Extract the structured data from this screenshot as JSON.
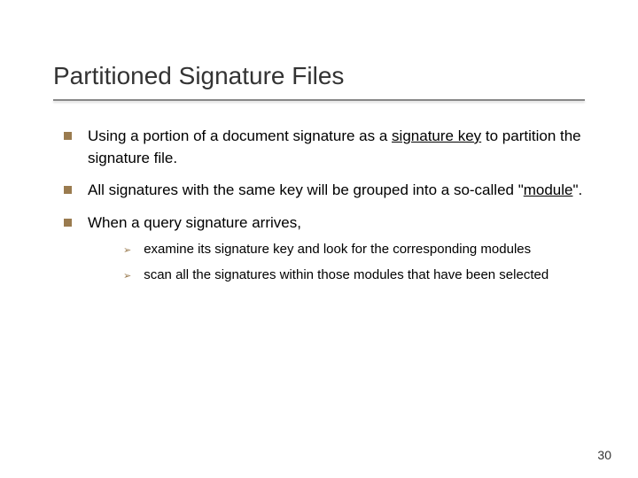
{
  "title": "Partitioned Signature Files",
  "bullets": [
    {
      "pre": "Using a portion of a document signature as a ",
      "underlined": "signature key",
      "post": " to partition the signature file."
    },
    {
      "pre": "All signatures with the same key will be grouped into a so-called \"",
      "underlined": "module",
      "post": "\"."
    },
    {
      "pre": "When a query signature arrives,",
      "underlined": "",
      "post": ""
    }
  ],
  "subbullets": [
    "examine its signature key and look for the corresponding modules",
    "scan all the signatures within those modules that have been selected"
  ],
  "pageNumber": "30"
}
